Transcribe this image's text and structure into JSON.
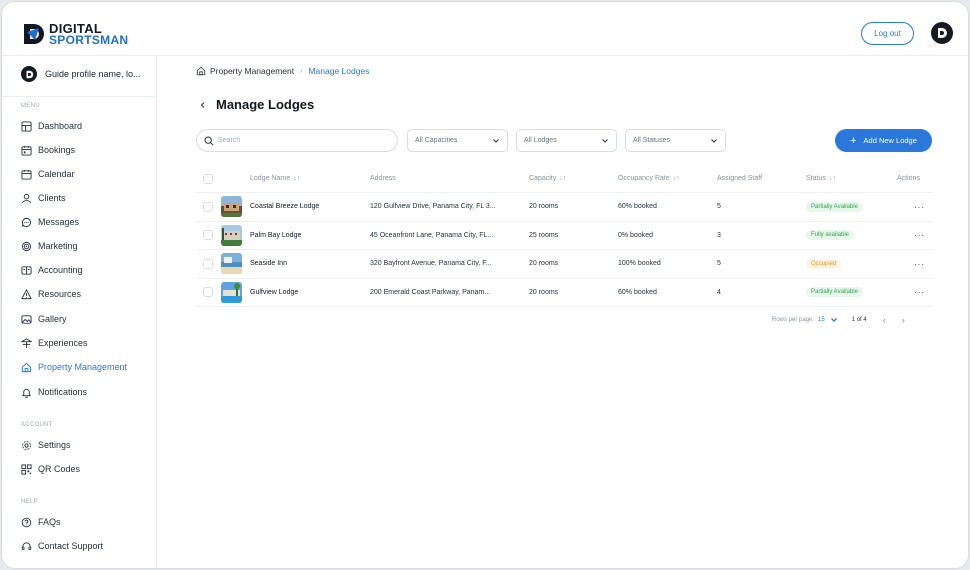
{
  "brand": {
    "line1": "DIGITAL",
    "line2": "SPORTSMAN",
    "accent": "#2a78dc"
  },
  "header": {
    "logout_label": "Log out",
    "avatar_icon": "brand-logo-icon"
  },
  "sidebar": {
    "profile_name": "Guide profile name, lo...",
    "menu_label": "MENU",
    "items": [
      {
        "label": "Dashboard",
        "icon": "dashboard-icon"
      },
      {
        "label": "Bookings",
        "icon": "bookings-icon"
      },
      {
        "label": "Calendar",
        "icon": "calendar-icon"
      },
      {
        "label": "Clients",
        "icon": "clients-icon"
      },
      {
        "label": "Messages",
        "icon": "messages-icon"
      },
      {
        "label": "Marketing",
        "icon": "marketing-icon"
      },
      {
        "label": "Accounting",
        "icon": "accounting-icon"
      },
      {
        "label": "Resources",
        "icon": "resources-icon"
      },
      {
        "label": "Gallery",
        "icon": "gallery-icon"
      },
      {
        "label": "Experiences",
        "icon": "experiences-icon"
      },
      {
        "label": "Property Management",
        "icon": "property-icon",
        "active": true
      },
      {
        "label": "Notifications",
        "icon": "bell-icon"
      }
    ],
    "account_label": "ACCOUNT",
    "account_items": [
      {
        "label": "Settings",
        "icon": "gear-icon"
      },
      {
        "label": "QR Codes",
        "icon": "qr-code-icon"
      }
    ],
    "help_label": "HELP",
    "help_items": [
      {
        "label": "FAQs",
        "icon": "question-icon"
      },
      {
        "label": "Contact Support",
        "icon": "headset-icon"
      }
    ]
  },
  "breadcrumb": {
    "parent": "Property Management",
    "separator": "›",
    "current": "Manage Lodges"
  },
  "page": {
    "title": "Manage Lodges"
  },
  "toolbar": {
    "search_placeholder": "Search",
    "filters": [
      {
        "label": "All Capacities"
      },
      {
        "label": "All Lodges"
      },
      {
        "label": "All Statuses"
      }
    ],
    "add_label": "Add New Lodge"
  },
  "table": {
    "columns": {
      "name": "Lodge Name",
      "address": "Address",
      "capacity": "Capacity",
      "occupancy": "Occupancy Rate",
      "staff": "Assigned Staff",
      "status": "Status",
      "actions": "Actions"
    },
    "rows": [
      {
        "name": "Coastal Breeze Lodge",
        "address": "120 Gulfview Drive, Panama City, FL 3...",
        "capacity": "20 rooms",
        "occupancy": "60% booked",
        "staff": "5",
        "status": "Partially Available",
        "status_color": "green"
      },
      {
        "name": "Palm Bay Lodge",
        "address": "45 Oceanfront Lane, Panama City, FL...",
        "capacity": "25 rooms",
        "occupancy": "0% booked",
        "staff": "3",
        "status": "Fully available",
        "status_color": "green"
      },
      {
        "name": "Seaside Inn",
        "address": "320 Bayfront Avenue, Panama City, F...",
        "capacity": "20 rooms",
        "occupancy": "100% booked",
        "staff": "5",
        "status": "Occupied",
        "status_color": "orange"
      },
      {
        "name": "Gulfview Lodge",
        "address": "200 Emerald Coast Parkway, Panam...",
        "capacity": "20 rooms",
        "occupancy": "60% booked",
        "staff": "4",
        "status": "Partially Available",
        "status_color": "green"
      }
    ]
  },
  "pagination": {
    "rows_per_page_label": "Rows per page:",
    "rows_per_page": "15",
    "page_info": "1 of 4"
  }
}
